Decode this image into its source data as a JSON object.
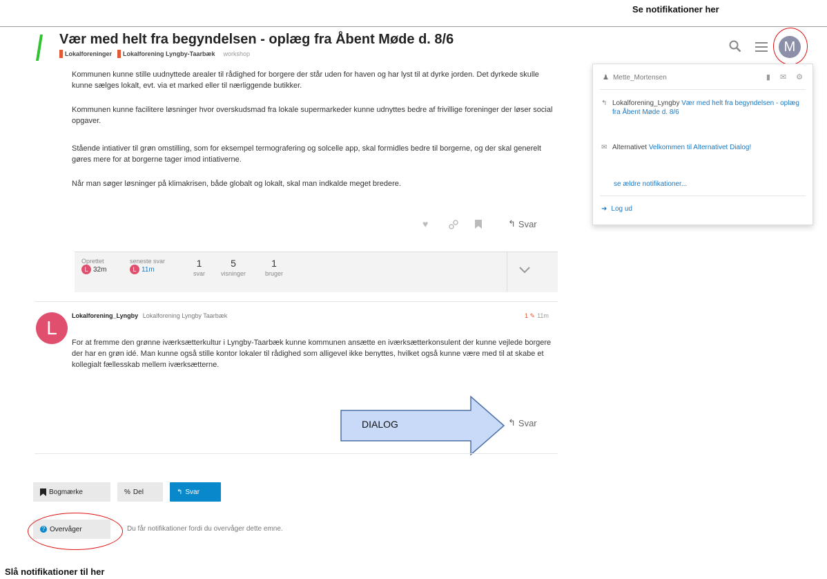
{
  "annotations": {
    "top_note": "Se notifikationer her",
    "bottom_note": "Slå notifikationer til her",
    "dialog_label": "DIALOG"
  },
  "colors": {
    "logo": "#2fc32f",
    "accent": "#0a88cc",
    "category": "#e45735",
    "avatar_post": "#e0506e",
    "avatar_user": "#8b8fa8",
    "annotation_red": "#e01010"
  },
  "header": {
    "title": "Vær med helt fra begyndelsen - oplæg fra Åbent Møde d. 8/6",
    "categories": [
      {
        "label": "Lokalforeninger"
      },
      {
        "label": "Lokalforening Lyngby-Taarbæk"
      }
    ],
    "tag": "workshop",
    "avatar_letter": "M",
    "icons": {
      "search": "search-icon",
      "menu": "hamburger-menu-icon"
    }
  },
  "first_post": {
    "paragraphs": [
      "Kommunen kunne stille uudnyttede arealer til rådighed for borgere der står uden for haven og har lyst til at dyrke jorden. Det dyrkede skulle kunne sælges lokalt, evt. via et marked eller til nærliggende butikker.",
      "Kommunen kunne facilitere løsninger hvor overskudsmad fra lokale supermarkeder kunne udnyttes bedre af frivillige foreninger der løser social opgaver.",
      "Stående intiativer til grøn omstilling, som for eksempel termografering og solcelle app, skal formidles bedre til borgerne, og der skal generelt gøres mere for at borgerne tager imod intiativerne.",
      "Når man søger løsninger på klimakrisen, både globalt og lokalt, skal man indkalde meget bredere."
    ],
    "reply_label": "Svar"
  },
  "summary": {
    "created_label": "Oprettet",
    "created_time": "32m",
    "last_reply_label": "seneste svar",
    "last_reply_time": "11m",
    "avatar_letter": "L",
    "replies_count": "1",
    "replies_label": "svar",
    "views_count": "5",
    "views_label": "visninger",
    "users_count": "1",
    "users_label": "bruger"
  },
  "second_post": {
    "avatar_letter": "L",
    "username": "Lokalforening_Lyngby",
    "full_name": "Lokalforening Lyngby Taarbæk",
    "edit_count": "1",
    "time": "11m",
    "text": "For at fremme den grønne iværksætterkultur i Lyngby-Taarbæk kunne kommunen ansætte en iværksætterkonsulent der kunne vejlede borgere der har en grøn idé. Man kunne også stille kontor lokaler til rådighed som alligevel ikke benyttes, hvilket også kunne være med til at skabe et kollegialt fællesskab mellem iværksætterne.",
    "reply_label": "Svar"
  },
  "footer": {
    "bookmark_label": "Bogmærke",
    "share_label": "Del",
    "reply_label": "Svar",
    "tracking_label": "Overvåger",
    "tracking_text": "Du får notifikationer fordi du overvåger dette emne."
  },
  "user_panel": {
    "username": "Mette_Mortensen",
    "notifications": [
      {
        "actor": "Lokalforening_Lyngby",
        "link": "Vær med helt fra begyndelsen - oplæg fra Åbent Møde d. 8/6",
        "icon": "reply-icon"
      },
      {
        "actor": "Alternativet",
        "link": "Velkommen til Alternativet Dialog!",
        "icon": "envelope-icon"
      }
    ],
    "older_label": "se ældre notifikationer...",
    "logout_label": "Log ud"
  }
}
